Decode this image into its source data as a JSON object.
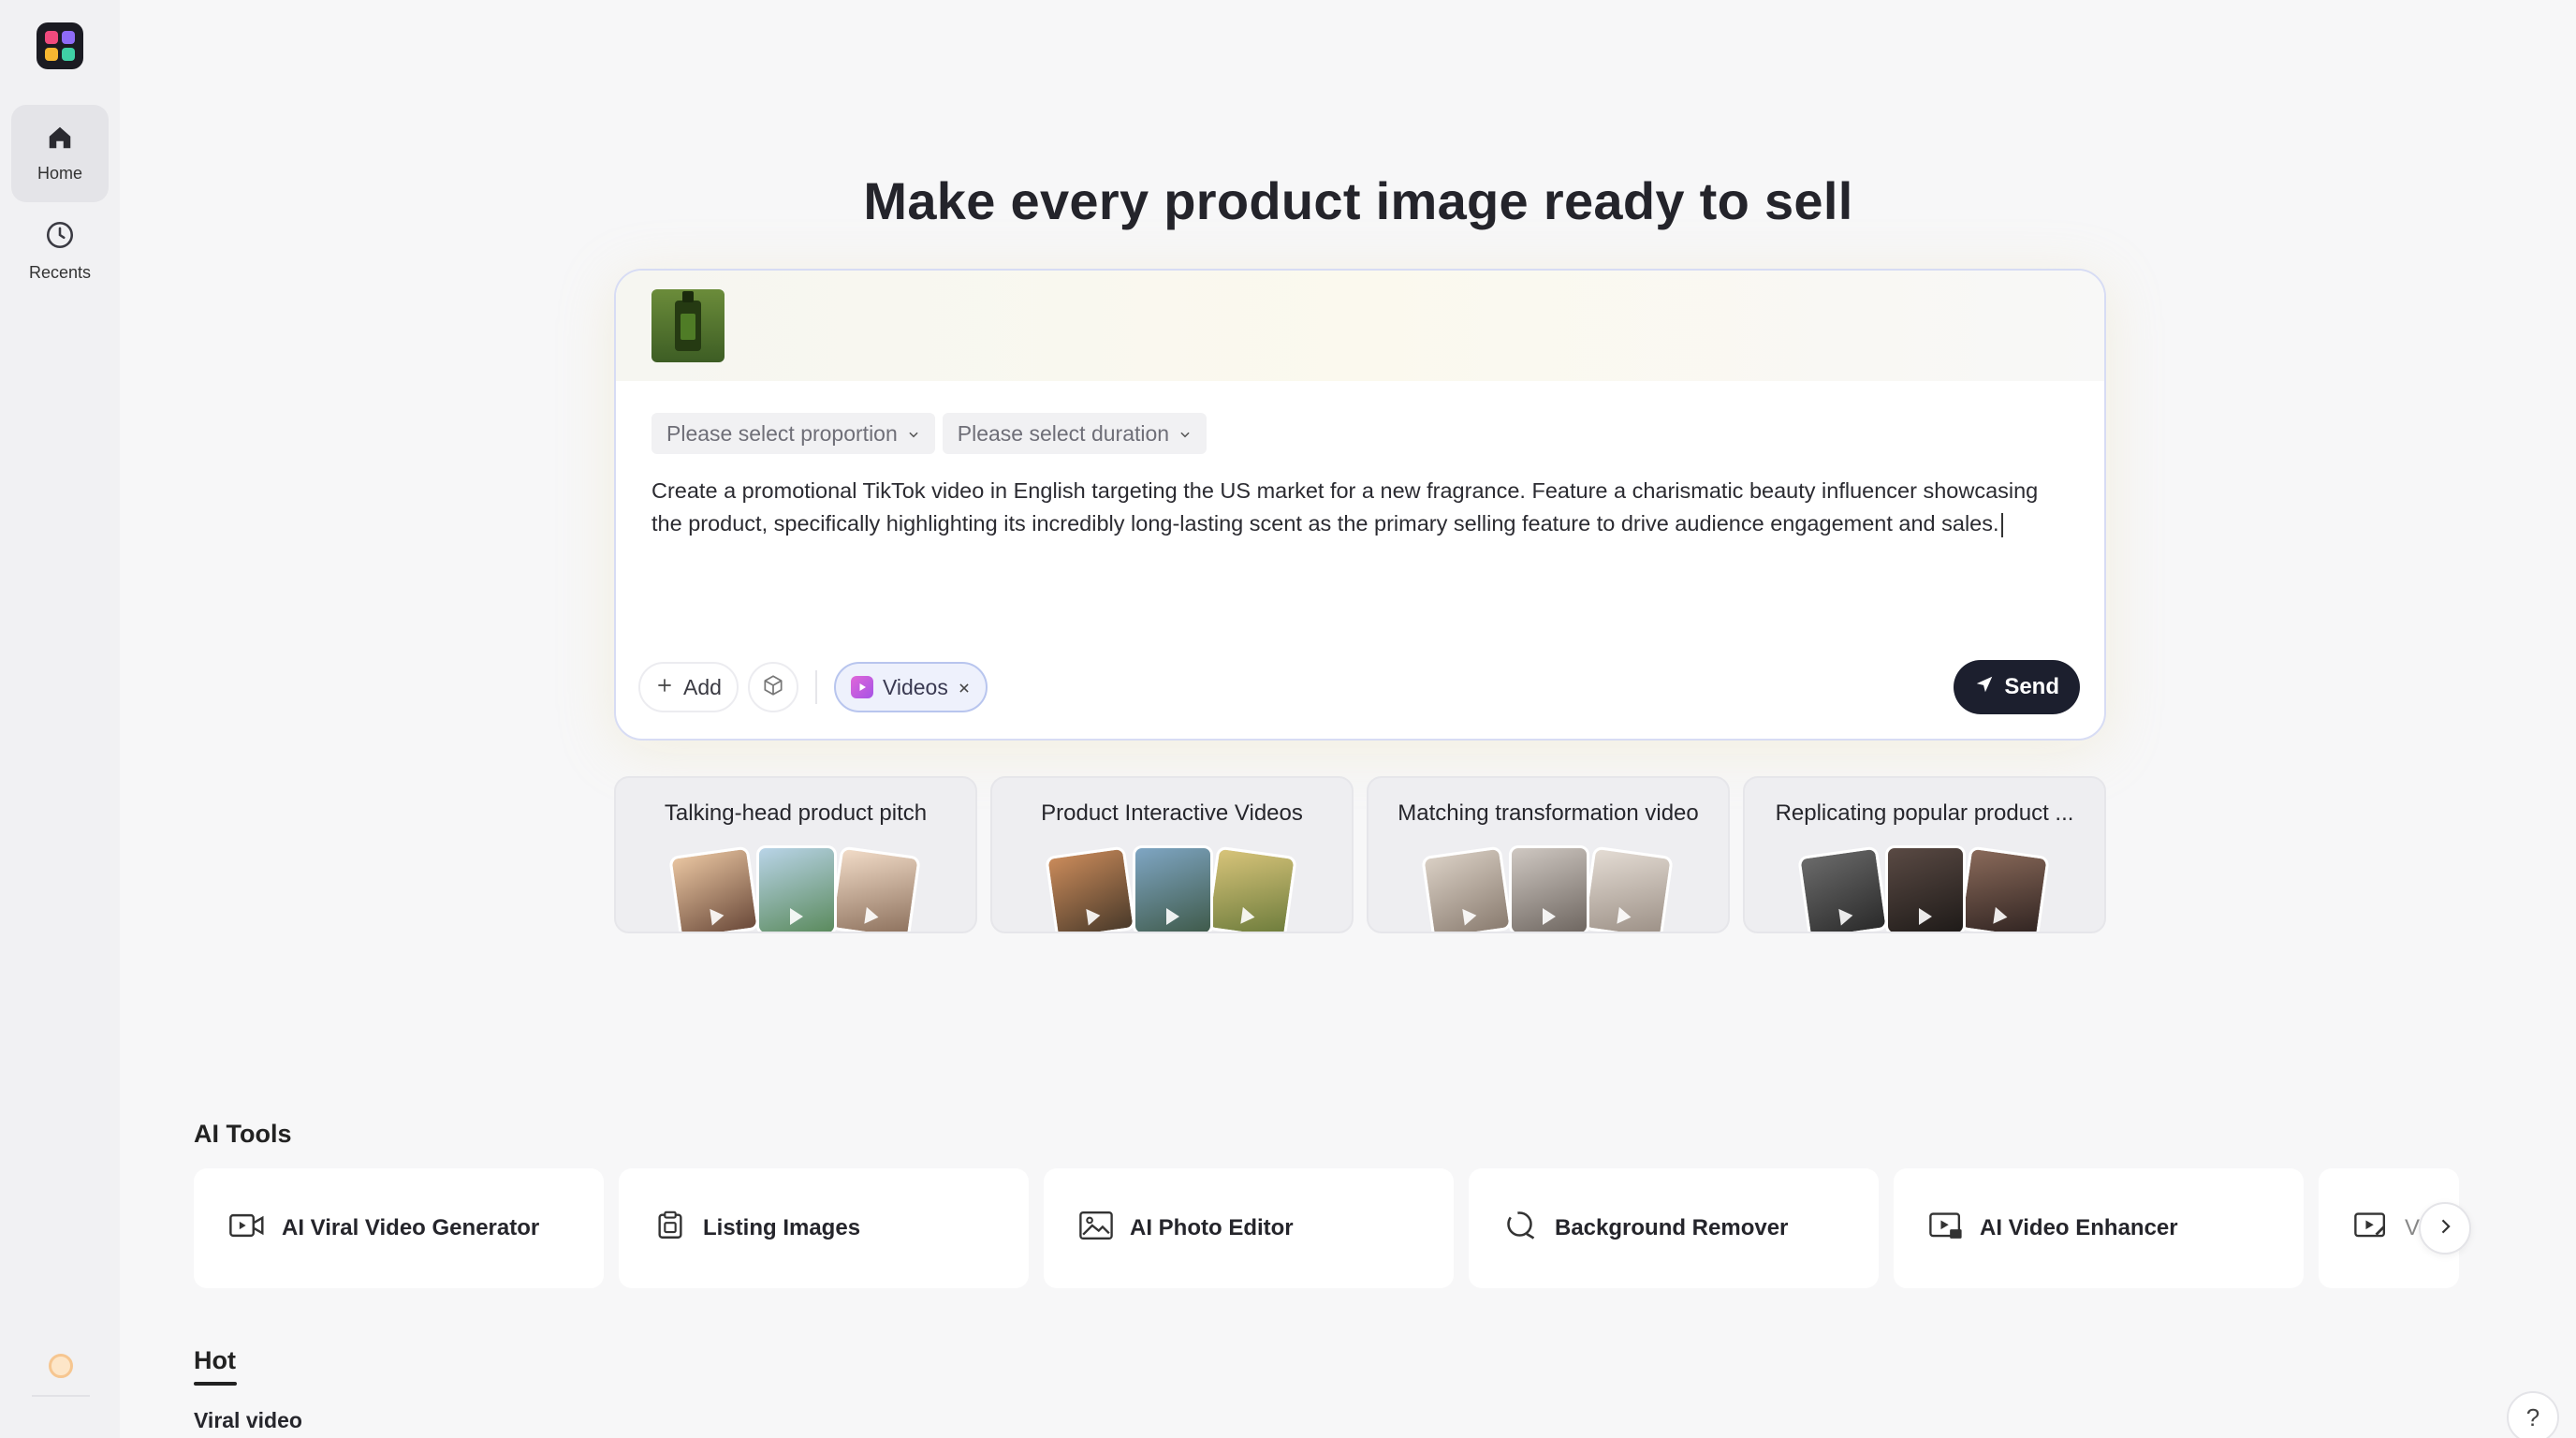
{
  "sidebar": {
    "logo_icon": "app-logo-icon",
    "items": [
      {
        "label": "Home",
        "icon": "home-icon",
        "active": true
      },
      {
        "label": "Recents",
        "icon": "clock-icon",
        "active": false
      }
    ]
  },
  "hero": {
    "title": "Make every product image ready to sell"
  },
  "prompt": {
    "proportion_placeholder": "Please select proportion",
    "duration_placeholder": "Please select duration",
    "text": "Create a promotional TikTok video in English targeting the US market for a new fragrance. Feature a charismatic beauty influencer showcasing the product, specifically highlighting its incredibly long-lasting scent as the primary selling feature to drive audience engagement and sales.",
    "add_label": "Add",
    "tag_label": "Videos",
    "send_label": "Send"
  },
  "templates": [
    {
      "title": "Talking-head product pitch"
    },
    {
      "title": "Product Interactive Videos"
    },
    {
      "title": "Matching transformation video"
    },
    {
      "title": "Replicating popular product ..."
    }
  ],
  "ai_tools": {
    "title": "AI Tools",
    "items": [
      {
        "label": "AI Viral Video Generator",
        "icon": "video-camera-icon"
      },
      {
        "label": "Listing Images",
        "icon": "listing-icon"
      },
      {
        "label": "AI Photo Editor",
        "icon": "photo-icon"
      },
      {
        "label": "Background Remover",
        "icon": "eraser-icon"
      },
      {
        "label": "AI Video Enhancer",
        "icon": "hd-video-icon"
      },
      {
        "label": "V",
        "icon": "video-edit-icon"
      }
    ]
  },
  "hot": {
    "tab_label": "Hot",
    "section_label": "Viral video"
  },
  "help_label": "?",
  "colors": {
    "accent": "#1c1f2e",
    "tag_border": "#b8c5ee",
    "background": "#f7f7f8"
  }
}
